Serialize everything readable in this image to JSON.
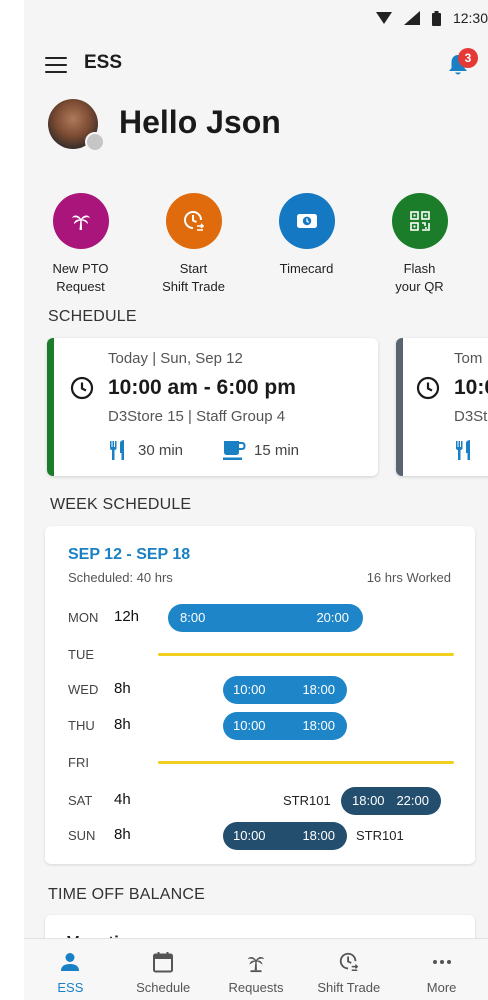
{
  "status_bar": {
    "time": "12:30"
  },
  "app_bar": {
    "title": "ESS",
    "notification_count": "3"
  },
  "greeting": "Hello Json",
  "quick_actions": [
    {
      "label": "New PTO\nRequest",
      "icon": "palm-tree-icon",
      "color": "#a9157a"
    },
    {
      "label": "Start\nShift Trade",
      "icon": "shift-trade-clock-icon",
      "color": "#e06b0c"
    },
    {
      "label": "Timecard",
      "icon": "timecard-icon",
      "color": "#1478c2"
    },
    {
      "label": "Flash\nyour QR",
      "icon": "qr-code-icon",
      "color": "#1b7d2a"
    }
  ],
  "schedule": {
    "title": "SCHEDULE",
    "cards": [
      {
        "date": "Today | Sun, Sep 12",
        "time": "10:00 am - 6:00 pm",
        "store": "D3Store 15 | Staff Group 4",
        "meal_break": "30 min",
        "rest_break": "15 min",
        "accent": "#1b7d2a"
      },
      {
        "date": "Tom",
        "time": "10:0",
        "store": "D3St",
        "accent": "#5a6470"
      }
    ]
  },
  "week_schedule": {
    "title": "WEEK SCHEDULE",
    "range": "SEP 12 - SEP 18",
    "scheduled": "Scheduled: 40 hrs",
    "worked": "16 hrs Worked",
    "days": [
      {
        "day": "MON",
        "hours": "12h",
        "start": "8:00",
        "end": "20:00",
        "store": ""
      },
      {
        "day": "TUE",
        "hours": "",
        "start": "",
        "end": "",
        "store": ""
      },
      {
        "day": "WED",
        "hours": "8h",
        "start": "10:00",
        "end": "18:00",
        "store": ""
      },
      {
        "day": "THU",
        "hours": "8h",
        "start": "10:00",
        "end": "18:00",
        "store": ""
      },
      {
        "day": "FRI",
        "hours": "",
        "start": "",
        "end": "",
        "store": ""
      },
      {
        "day": "SAT",
        "hours": "4h",
        "start": "18:00",
        "end": "22:00",
        "store": "STR101"
      },
      {
        "day": "SUN",
        "hours": "8h",
        "start": "10:00",
        "end": "18:00",
        "store": "STR101"
      }
    ],
    "colors": {
      "shift_blue": "#1e86c8",
      "shift_dark": "#244e6e",
      "day_off": "#f2cf1f"
    }
  },
  "time_off": {
    "title": "TIME OFF BALANCE",
    "first_item": "Vacation"
  },
  "bottom_nav": [
    {
      "label": "ESS",
      "icon": "person-icon",
      "active": true
    },
    {
      "label": "Schedule",
      "icon": "calendar-icon",
      "active": false
    },
    {
      "label": "Requests",
      "icon": "palm-tree-icon",
      "active": false
    },
    {
      "label": "Shift Trade",
      "icon": "shift-trade-clock-icon",
      "active": false
    },
    {
      "label": "More",
      "icon": "more-dots-icon",
      "active": false
    }
  ]
}
